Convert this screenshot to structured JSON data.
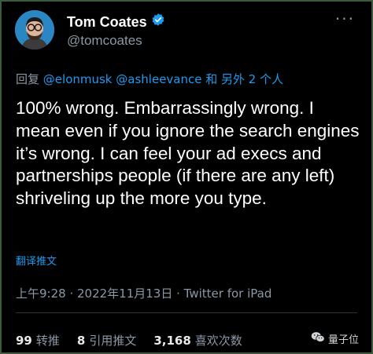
{
  "author": {
    "display_name": "Tom Coates",
    "handle": "@tomcoates",
    "verified_icon": "verified-badge-icon",
    "avatar_icon": "avatar-illustration"
  },
  "more_icon": "more-options-icon",
  "reply": {
    "prefix": "回复",
    "mention_1": "@elonmusk",
    "mention_2": "@ashleevance",
    "suffix": "和 另外 2 个人"
  },
  "tweet": {
    "text": "100% wrong. Embarrassingly wrong. I mean even if you ignore the search engines it’s wrong. I can feel your ad execs and partnerships people (if there are any left) shriveling up the more you type."
  },
  "translate_label": "翻译推文",
  "meta": {
    "time": "上午9:28",
    "separator": " · ",
    "date": "2022年11月13日",
    "source": "Twitter for iPad"
  },
  "stats": {
    "retweets_count": "99",
    "retweets_label": "转推",
    "quotes_count": "8",
    "quotes_label": "引用推文",
    "likes_count": "3,168",
    "likes_label": "喜欢次数"
  },
  "watermark": {
    "icon": "wechat-icon",
    "label": "量子位"
  },
  "colors": {
    "background": "#000000",
    "text": "#e7e9ea",
    "secondary": "#8b98a5",
    "link": "#1d9bf0",
    "verified": "#1d9bf0"
  }
}
